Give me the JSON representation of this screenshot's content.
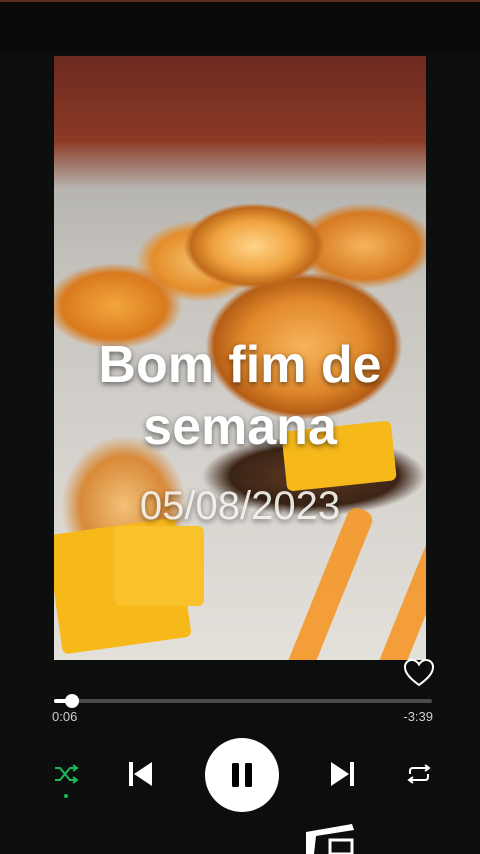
{
  "player": {
    "artwork": {
      "title_line1": "Bom fim de",
      "title_line2": "semana",
      "date": "05/08/2023",
      "description_icon": "burger-photo"
    },
    "progress": {
      "elapsed": "0:06",
      "remaining": "-3:39",
      "fraction": 0.03
    },
    "controls": {
      "shuffle_icon": "shuffle-icon",
      "previous_icon": "skip-previous-icon",
      "play_pause_icon": "pause-icon",
      "next_icon": "skip-next-icon",
      "repeat_icon": "repeat-icon",
      "like_icon": "heart-outline-icon"
    },
    "colors": {
      "background": "#0c0d0d",
      "shuffle_active": "#1db954",
      "track": "#4a4b4b",
      "fill": "#ffffff"
    }
  }
}
